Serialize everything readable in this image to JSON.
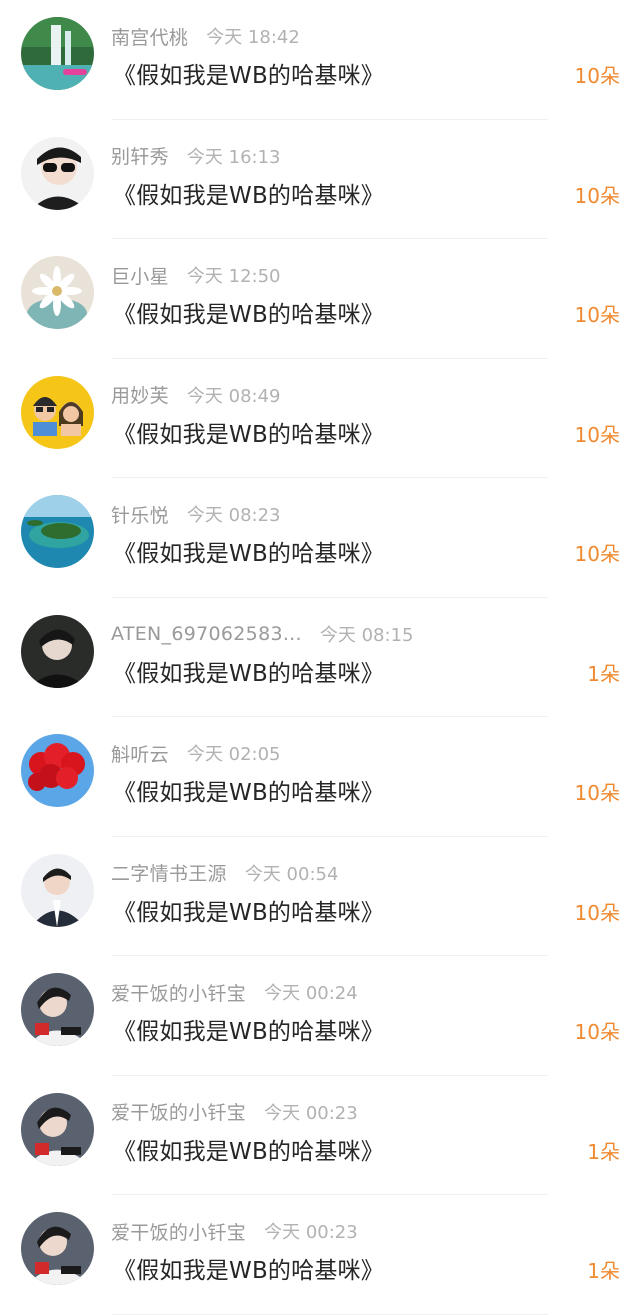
{
  "gift_list": {
    "items": [
      {
        "name": "南宫代桃",
        "time": "今天 18:42",
        "title": "《假如我是WB的哈基咪》",
        "amount": "10朵",
        "avatar_icon": "waterfall-landscape-avatar"
      },
      {
        "name": "别轩秀",
        "time": "今天 16:13",
        "title": "《假如我是WB的哈基咪》",
        "amount": "10朵",
        "avatar_icon": "sunglasses-portrait-avatar"
      },
      {
        "name": "巨小星",
        "time": "今天 12:50",
        "title": "《假如我是WB的哈基咪》",
        "amount": "10朵",
        "avatar_icon": "daisy-flower-avatar"
      },
      {
        "name": "用妙芙",
        "time": "今天 08:49",
        "title": "《假如我是WB的哈基咪》",
        "amount": "10朵",
        "avatar_icon": "cartoon-couple-avatar"
      },
      {
        "name": "针乐悦",
        "time": "今天 08:23",
        "title": "《假如我是WB的哈基咪》",
        "amount": "10朵",
        "avatar_icon": "island-avatar"
      },
      {
        "name": "ATEN_697062583...",
        "time": "今天 08:15",
        "title": "《假如我是WB的哈基咪》",
        "amount": "1朵",
        "avatar_icon": "dark-portrait-avatar"
      },
      {
        "name": "斛听云",
        "time": "今天 02:05",
        "title": "《假如我是WB的哈基咪》",
        "amount": "10朵",
        "avatar_icon": "red-balloons-avatar"
      },
      {
        "name": "二字情书王源",
        "time": "今天 00:54",
        "title": "《假如我是WB的哈基咪》",
        "amount": "10朵",
        "avatar_icon": "portrait-avatar"
      },
      {
        "name": "爱干饭的小钎宝",
        "time": "今天 00:24",
        "title": "《假如我是WB的哈基咪》",
        "amount": "10朵",
        "avatar_icon": "racer-portrait-avatar"
      },
      {
        "name": "爱干饭的小钎宝",
        "time": "今天 00:23",
        "title": "《假如我是WB的哈基咪》",
        "amount": "1朵",
        "avatar_icon": "racer-portrait-avatar"
      },
      {
        "name": "爱干饭的小钎宝",
        "time": "今天 00:23",
        "title": "《假如我是WB的哈基咪》",
        "amount": "1朵",
        "avatar_icon": "racer-portrait-avatar"
      }
    ]
  },
  "colors": {
    "accent": "#f08a30",
    "name": "#9a9a9a",
    "time": "#b2b2b2",
    "title": "#262626"
  }
}
